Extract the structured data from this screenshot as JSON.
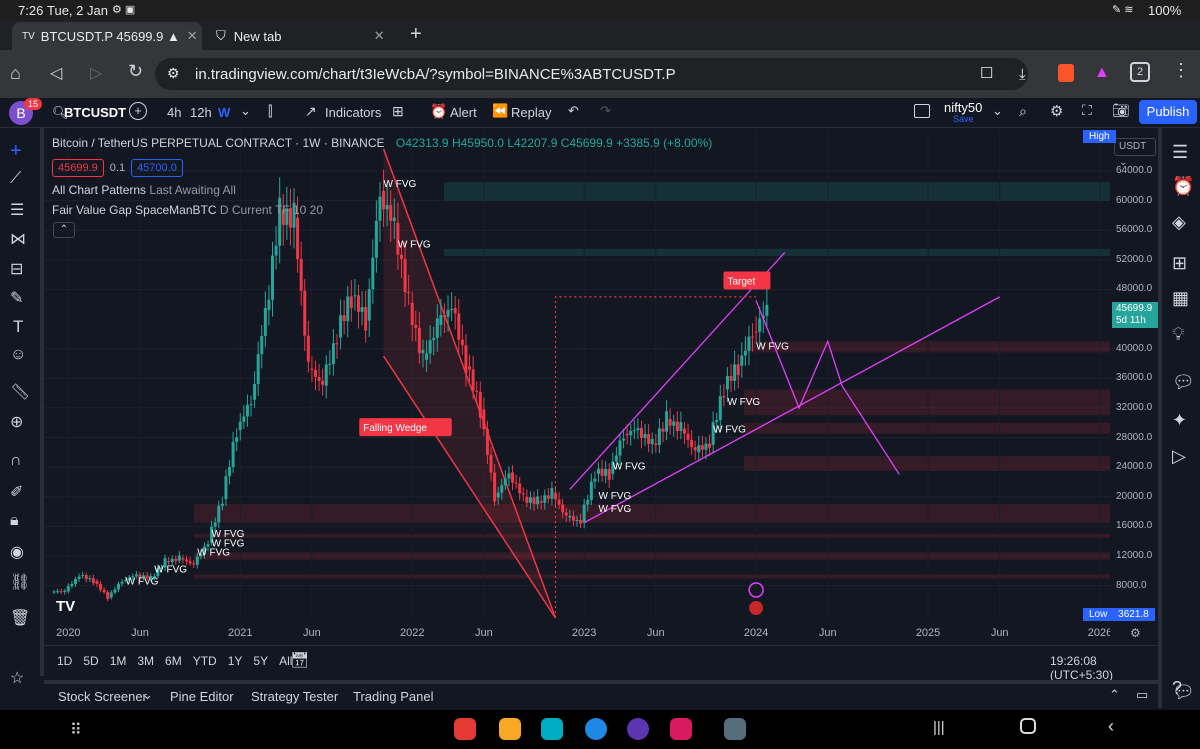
{
  "status": {
    "time": "7:26",
    "date": "Tue, 2 Jan",
    "battery": "100%"
  },
  "browser": {
    "tabs": [
      {
        "label": "BTCUSDT.P 45699.9 ▲ +3.3",
        "active": true
      },
      {
        "label": "New tab",
        "active": false
      }
    ],
    "url": "in.tradingview.com/chart/t3IeWcbA/?symbol=BINANCE%3ABTCUSDT.P",
    "tab_count": "2"
  },
  "tv_toolbar": {
    "avatar_letter": "B",
    "avatar_badge": "15",
    "symbol": "BTCUSDT",
    "intervals": [
      "4h",
      "12h",
      "W"
    ],
    "indicators": "Indicators",
    "alert": "Alert",
    "replay": "Replay",
    "layout_name": "nifty50",
    "layout_sub": "Save",
    "publish": "Publish"
  },
  "legend": {
    "title": "Bitcoin / TetherUS PERPETUAL CONTRACT · 1W · BINANCE",
    "ohlc": {
      "o": "O42313.9",
      "h": "H45950.0",
      "l": "L42207.9",
      "c": "C45699.9",
      "chg": "+3385.9 (+8.00%)"
    },
    "bid": "45699.9",
    "spread": "0.1",
    "ask": "45700.0",
    "indicator1_name": "All Chart Patterns",
    "indicator1_args": "Last Awaiting All",
    "indicator2_name": "Fair Value Gap SpaceManBTC",
    "indicator2_args": "D Current TF 10 20"
  },
  "annotations": {
    "target": "Target",
    "falling_wedge": "Falling Wedge",
    "fvg": "W FVG",
    "high_label": "High",
    "low_label": "Low",
    "low_value": "3621.8"
  },
  "yaxis": {
    "currency": "USDT",
    "ticks": [
      "64000.0",
      "60000.0",
      "56000.0",
      "52000.0",
      "48000.0",
      "40000.0",
      "36000.0",
      "32000.0",
      "28000.0",
      "24000.0",
      "20000.0",
      "16000.0",
      "12000.0",
      "8000.0"
    ],
    "price_tag": "45699.9",
    "countdown": "5d 11h"
  },
  "xaxis": {
    "ticks": [
      "2020",
      "Jun",
      "2021",
      "Jun",
      "2022",
      "Jun",
      "2023",
      "Jun",
      "2024",
      "Jun",
      "2025",
      "Jun",
      "2026"
    ]
  },
  "timeframes": [
    "1D",
    "5D",
    "1M",
    "3M",
    "6M",
    "YTD",
    "1Y",
    "5Y",
    "All"
  ],
  "clock": "19:26:08 (UTC+5:30)",
  "bottom_tabs": [
    "Stock Screener",
    "Pine Editor",
    "Strategy Tester",
    "Trading Panel"
  ],
  "colors": {
    "up": "#26a69a",
    "down": "#f23645",
    "accent": "#2962ff",
    "pattern": "#e040fb",
    "wedge": "#f23645"
  },
  "chart_data": {
    "type": "candlestick",
    "x": [
      "2019-12",
      "2020-01",
      "2020-02",
      "2020-03",
      "2020-04",
      "2020-05",
      "2020-06",
      "2020-07",
      "2020-08",
      "2020-09",
      "2020-10",
      "2020-11",
      "2020-12",
      "2021-01",
      "2021-02",
      "2021-03",
      "2021-04",
      "2021-05",
      "2021-06",
      "2021-07",
      "2021-08",
      "2021-09",
      "2021-10",
      "2021-11",
      "2021-12",
      "2022-01",
      "2022-02",
      "2022-03",
      "2022-04",
      "2022-05",
      "2022-06",
      "2022-07",
      "2022-08",
      "2022-09",
      "2022-10",
      "2022-11",
      "2022-12",
      "2023-01",
      "2023-02",
      "2023-03",
      "2023-04",
      "2023-05",
      "2023-06",
      "2023-07",
      "2023-08",
      "2023-09",
      "2023-10",
      "2023-11",
      "2023-12",
      "2024-01"
    ],
    "close": [
      7200,
      9300,
      8600,
      6400,
      8700,
      9500,
      9100,
      11300,
      11700,
      10800,
      13800,
      19700,
      29000,
      33100,
      45200,
      58800,
      57700,
      37300,
      35000,
      41500,
      47100,
      43800,
      61300,
      57000,
      46200,
      38500,
      43200,
      45500,
      37600,
      31800,
      19900,
      23300,
      20000,
      19400,
      20500,
      17200,
      16500,
      23100,
      23100,
      28500,
      29300,
      27200,
      30500,
      29200,
      26000,
      27000,
      34500,
      37700,
      42300,
      45699.9
    ],
    "ylim": [
      3621.8,
      69000
    ],
    "xlim": [
      "2019-12",
      "2026-01"
    ],
    "log_scale": false,
    "fvg_zones": [
      [
        60000,
        62500
      ],
      [
        52500,
        53500
      ],
      [
        39500,
        41000
      ],
      [
        31000,
        34500
      ],
      [
        28500,
        30000
      ],
      [
        23500,
        25500
      ],
      [
        16500,
        19000
      ],
      [
        14500,
        15000
      ],
      [
        11500,
        12500
      ],
      [
        9000,
        9500
      ]
    ],
    "target_price": 47000,
    "projection": [
      "2024-01",
      "2024-04",
      "2024-06",
      "2024-07",
      "2024-11"
    ]
  }
}
